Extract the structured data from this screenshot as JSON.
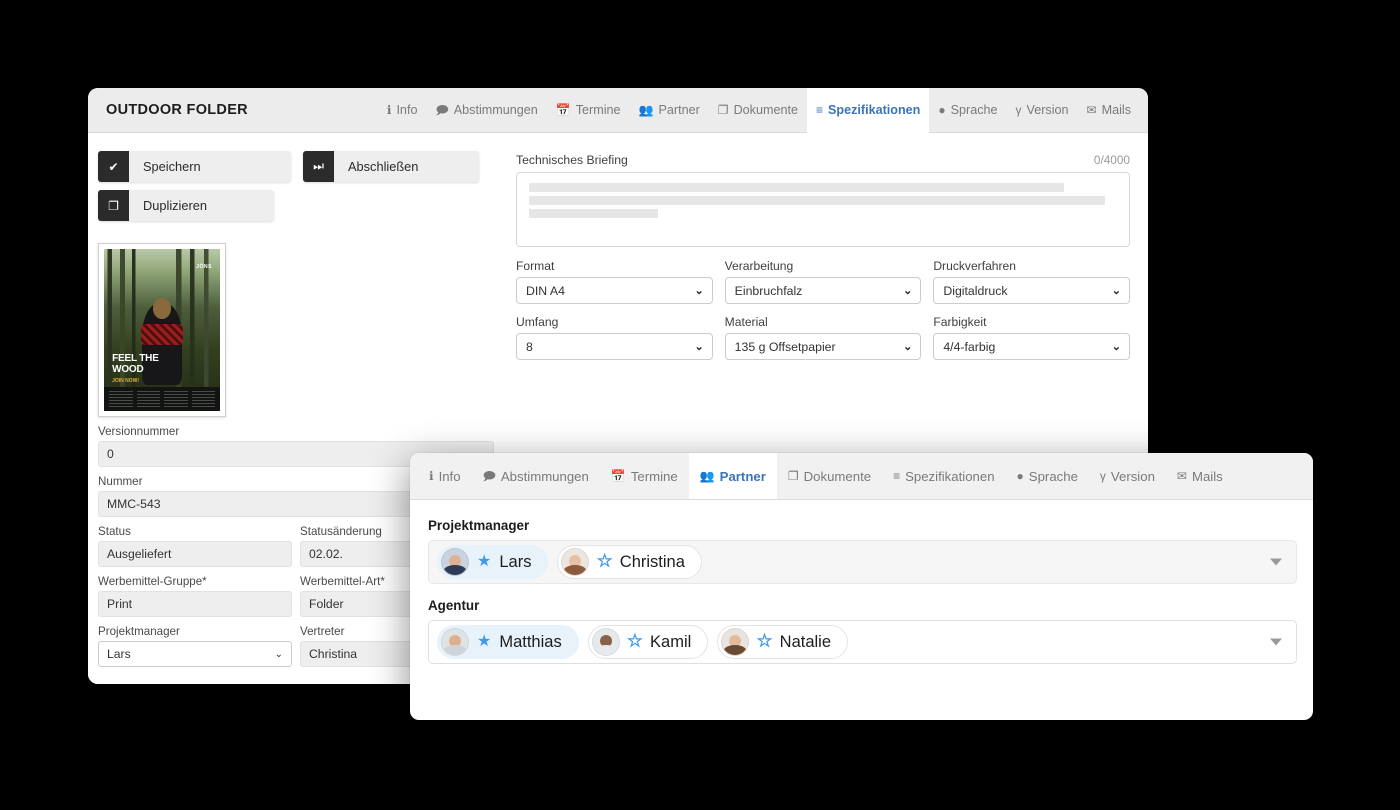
{
  "back_panel": {
    "title": "OUTDOOR FOLDER",
    "tabs": [
      {
        "label": "Info",
        "icon": "info-icon",
        "glyph": "ℹ",
        "active": false
      },
      {
        "label": "Abstimmungen",
        "icon": "comment-icon",
        "glyph": "🗩",
        "active": false
      },
      {
        "label": "Termine",
        "icon": "calendar-icon",
        "glyph": "📅",
        "active": false
      },
      {
        "label": "Partner",
        "icon": "users-icon",
        "glyph": "👥",
        "active": false
      },
      {
        "label": "Dokumente",
        "icon": "documents-icon",
        "glyph": "❐",
        "active": false
      },
      {
        "label": "Spezifikationen",
        "icon": "list-icon",
        "glyph": "≡",
        "active": true
      },
      {
        "label": "Sprache",
        "icon": "globe-icon",
        "glyph": "●",
        "active": false
      },
      {
        "label": "Version",
        "icon": "branch-icon",
        "glyph": "γ",
        "active": false
      },
      {
        "label": "Mails",
        "icon": "envelope-icon",
        "glyph": "✉",
        "active": false
      }
    ],
    "actions": [
      {
        "label": "Speichern",
        "icon": "check-icon",
        "glyph": "✔"
      },
      {
        "label": "Abschließen",
        "icon": "skip-forward-icon",
        "glyph": "⏭"
      },
      {
        "label": "Duplizieren",
        "icon": "copy-icon",
        "glyph": "❐"
      }
    ],
    "thumbnail": {
      "brand": "JÖNS",
      "headline_line1": "FEEL THE",
      "headline_line2": "WOOD",
      "sub": "JOIN NOW!",
      "url": "www.joens-outdoor.com"
    },
    "left_fields": {
      "versionnummer_label": "Versionnummer",
      "versionnummer_value": "0",
      "nummer_label": "Nummer",
      "nummer_value": "MMC-543",
      "status_label": "Status",
      "status_value": "Ausgeliefert",
      "statusaenderung_label": "Statusänderung",
      "statusaenderung_value": "02.02.",
      "gruppe_label": "Werbemittel-Gruppe*",
      "gruppe_value": "Print",
      "art_label": "Werbemittel-Art*",
      "art_value": "Folder",
      "projektmanager_label": "Projektmanager",
      "projektmanager_value": "Lars",
      "vertreter_label": "Vertreter",
      "vertreter_value": "Christina"
    },
    "briefing": {
      "label": "Technisches Briefing",
      "counter": "0/4000"
    },
    "spec_fields": [
      {
        "label": "Format",
        "value": "DIN A4"
      },
      {
        "label": "Verarbeitung",
        "value": "Einbruchfalz"
      },
      {
        "label": "Druckverfahren",
        "value": "Digitaldruck"
      },
      {
        "label": "Umfang",
        "value": "8"
      },
      {
        "label": "Material",
        "value": "135 g Offsetpapier"
      },
      {
        "label": "Farbigkeit",
        "value": "4/4-farbig"
      }
    ]
  },
  "front_panel": {
    "tabs": [
      {
        "label": "Info",
        "icon": "info-icon",
        "glyph": "ℹ",
        "active": false
      },
      {
        "label": "Abstimmungen",
        "icon": "comment-icon",
        "glyph": "🗩",
        "active": false
      },
      {
        "label": "Termine",
        "icon": "calendar-icon",
        "glyph": "📅",
        "active": false
      },
      {
        "label": "Partner",
        "icon": "users-icon",
        "glyph": "👥",
        "active": true
      },
      {
        "label": "Dokumente",
        "icon": "documents-icon",
        "glyph": "❐",
        "active": false
      },
      {
        "label": "Spezifikationen",
        "icon": "list-icon",
        "glyph": "≡",
        "active": false
      },
      {
        "label": "Sprache",
        "icon": "globe-icon",
        "glyph": "●",
        "active": false
      },
      {
        "label": "Version",
        "icon": "branch-icon",
        "glyph": "γ",
        "active": false
      },
      {
        "label": "Mails",
        "icon": "envelope-icon",
        "glyph": "✉",
        "active": false
      }
    ],
    "groups": [
      {
        "title": "Projektmanager",
        "people": [
          {
            "name": "Lars",
            "starred": true
          },
          {
            "name": "Christina",
            "starred": false
          }
        ]
      },
      {
        "title": "Agentur",
        "people": [
          {
            "name": "Matthias",
            "starred": true
          },
          {
            "name": "Kamil",
            "starred": false
          },
          {
            "name": "Natalie",
            "starred": false
          }
        ]
      }
    ]
  },
  "colors": {
    "accent_blue": "#3c74b9",
    "star_blue": "#3e9ae8",
    "chip_highlight": "#e8f2fb",
    "dark_button": "#2b2b2b",
    "background": "#000000"
  }
}
